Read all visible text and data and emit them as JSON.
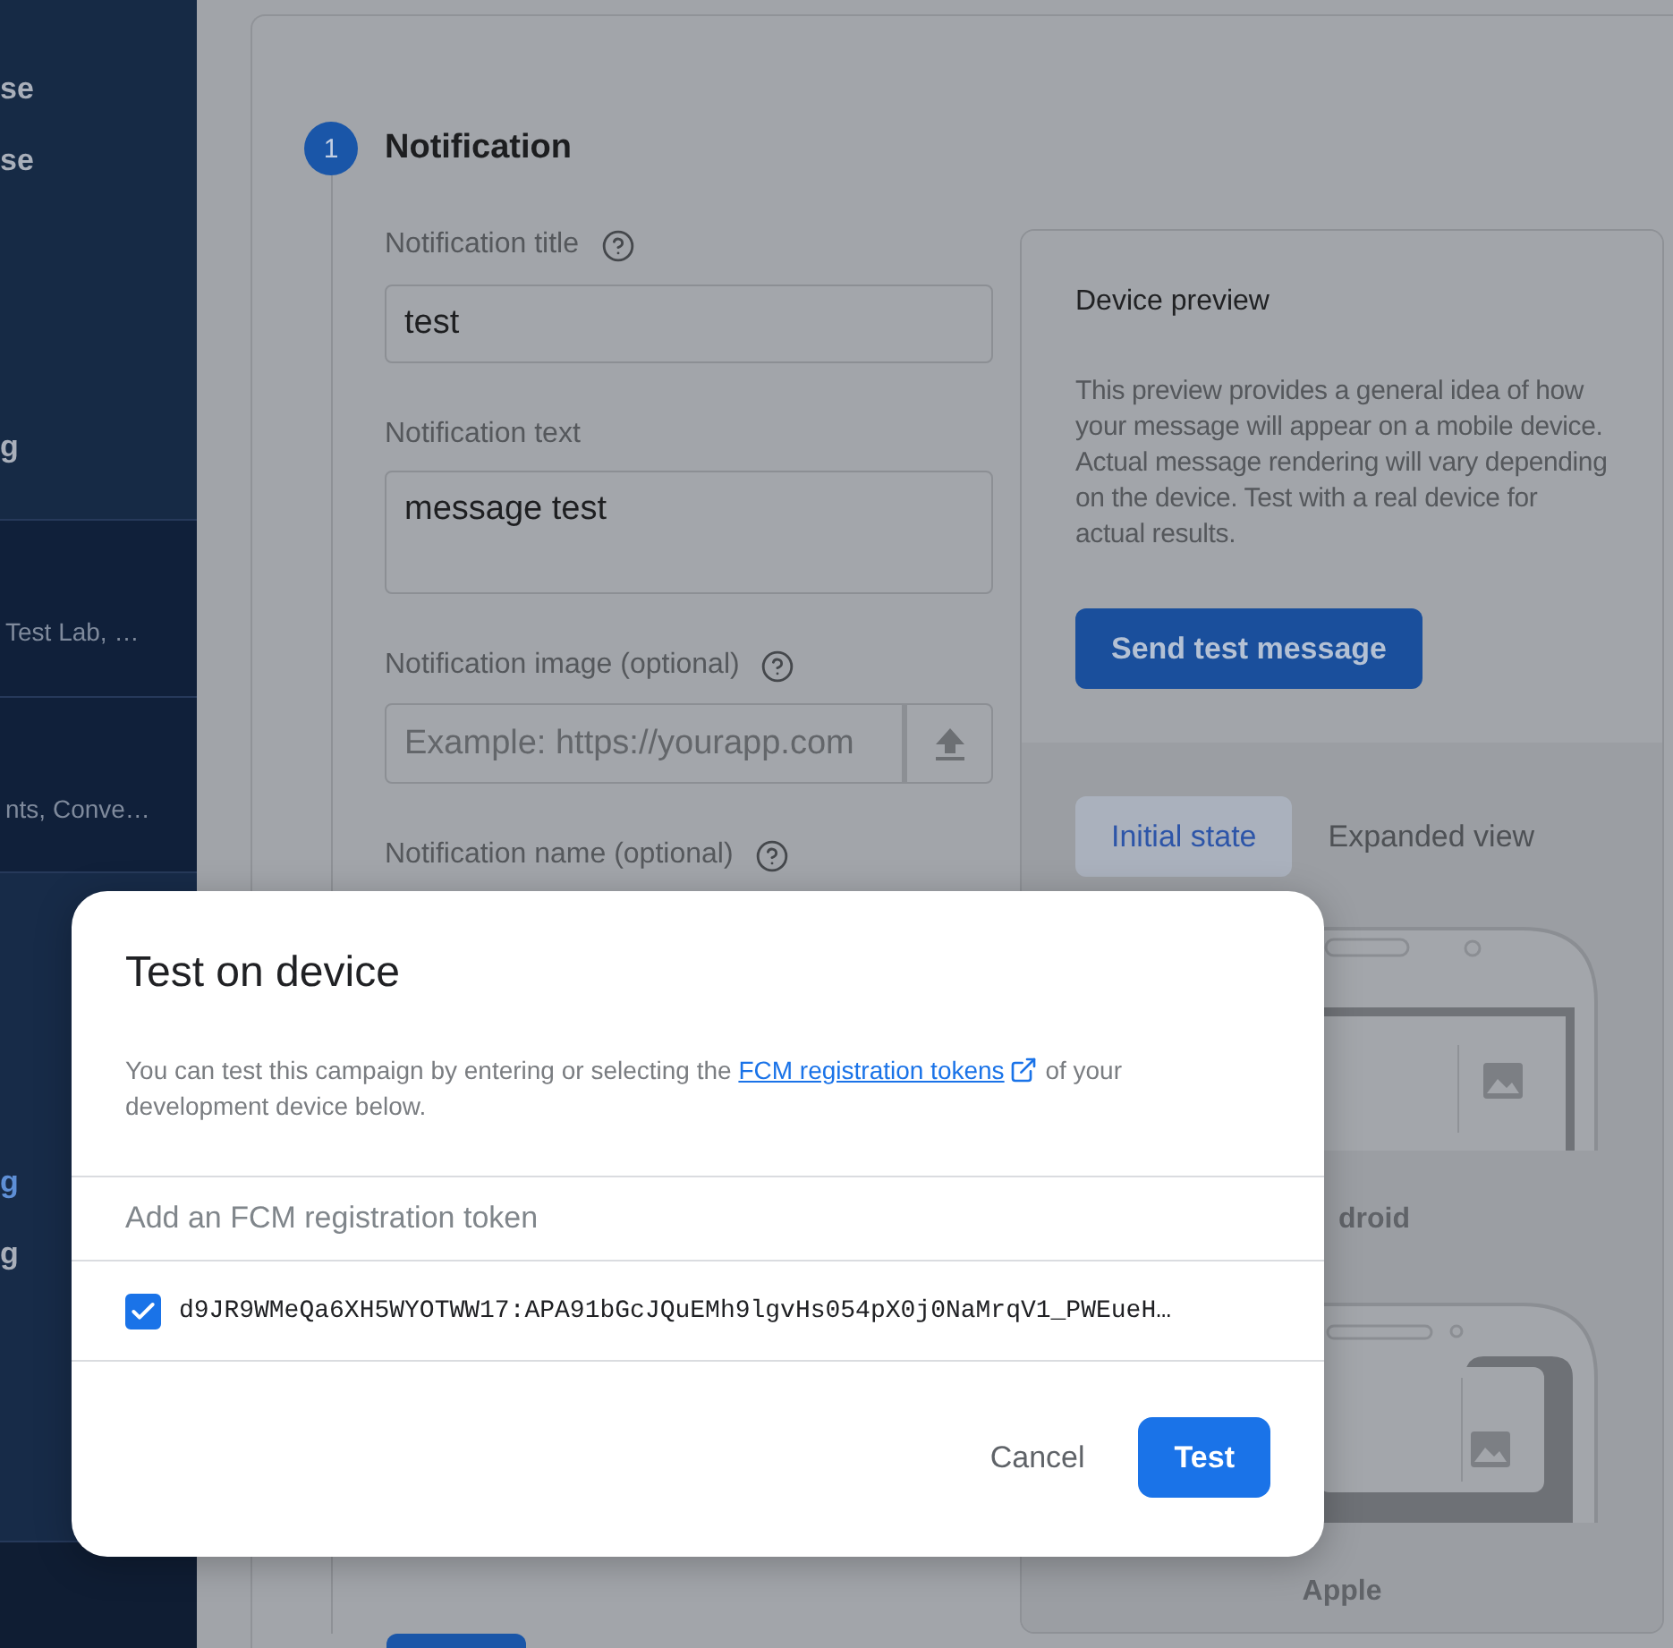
{
  "sidebar": {
    "sections": [
      {
        "items": [
          {
            "label": "se",
            "kind": "heading",
            "selected": false
          },
          {
            "label": "se",
            "kind": "heading",
            "selected": false
          },
          {
            "label": "g",
            "kind": "heading",
            "selected": false
          }
        ]
      },
      {
        "items": [
          {
            "label": "Test Lab, …",
            "kind": "caption",
            "selected": false
          }
        ]
      },
      {
        "items": [
          {
            "label": "nts, Conve…",
            "kind": "caption",
            "selected": false
          }
        ]
      },
      {
        "items": [
          {
            "label": "g",
            "kind": "heading",
            "selected": true
          },
          {
            "label": "g",
            "kind": "heading",
            "selected": false
          }
        ]
      }
    ]
  },
  "step": {
    "number": "1",
    "title": "Notification"
  },
  "fields": [
    {
      "label": "Notification title",
      "help": true,
      "kind": "text",
      "value": "test"
    },
    {
      "label": "Notification text",
      "help": false,
      "kind": "textarea",
      "value": "message test"
    },
    {
      "label": "Notification image (optional)",
      "help": true,
      "kind": "upload",
      "placeholder": "Example: https://yourapp.com"
    },
    {
      "label": "Notification name (optional)",
      "help": true,
      "kind": "label"
    }
  ],
  "preview": {
    "title": "Device preview",
    "description": "This preview provides a general idea of how your message will appear on a mobile device. Actual message rendering will vary depending on the device. Test with a real device for actual results.",
    "button": "Send test message",
    "tabs": [
      {
        "label": "Initial state",
        "selected": true
      },
      {
        "label": "Expanded view",
        "selected": false
      }
    ],
    "devices": [
      {
        "kind": "android",
        "label": "droid"
      },
      {
        "kind": "apple",
        "label": "Apple"
      }
    ]
  },
  "modal": {
    "title": "Test on device",
    "description": "You can test this campaign by entering or selecting the ",
    "link": "FCM registration tokens",
    "description_end": " of your development device below.",
    "token_placeholder": "Add an FCM registration token",
    "tokens": [
      {
        "value": "d9JR9WMeQa6XH5WYOTWW17:APA91bGcJQuEMh9lgvHs054pX0j0NaMrqV1_PWEueH…",
        "checked": true
      }
    ],
    "buttons": [
      {
        "label": "Cancel",
        "kind": "text"
      },
      {
        "label": "Test",
        "kind": "primary"
      }
    ]
  }
}
